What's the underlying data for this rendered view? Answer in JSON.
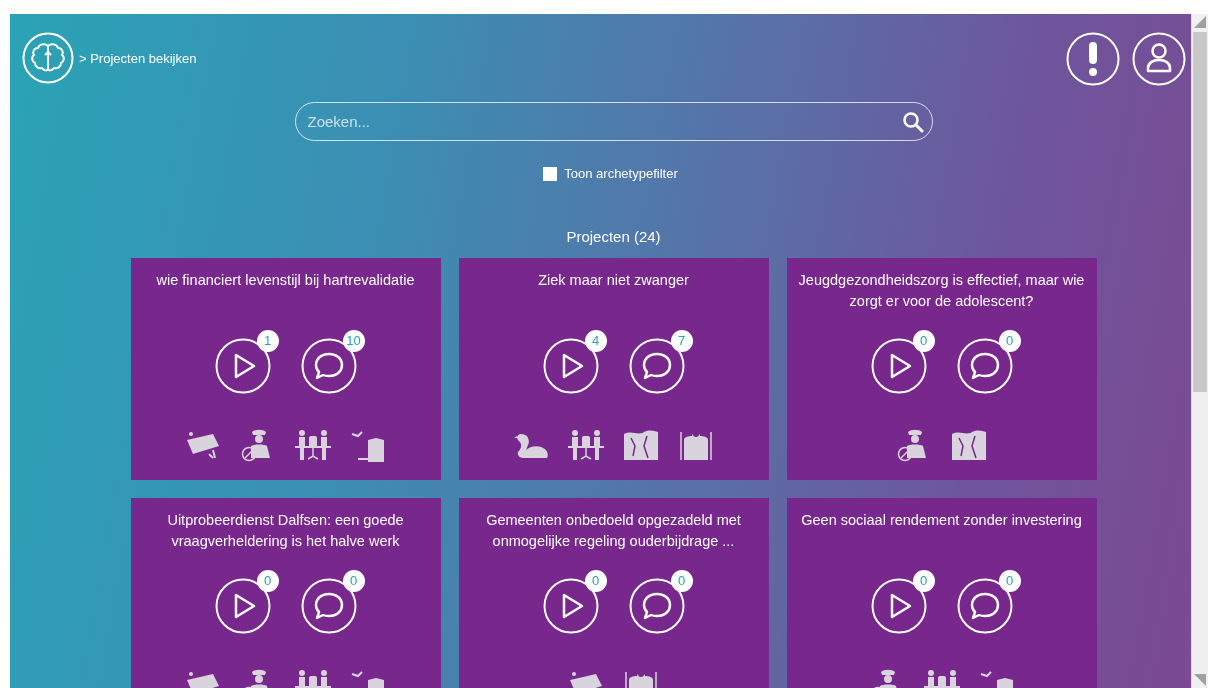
{
  "breadcrumb": "> Projecten bekijken",
  "search": {
    "placeholder": "Zoeken..."
  },
  "archetype_filter": {
    "label": "Toon archetypefilter",
    "checked": false
  },
  "projects_heading": "Projecten (24)",
  "projects": [
    {
      "title": "wie financiert levenstijl bij hartrevalidatie",
      "videos": "1",
      "comments": "10",
      "archetypes": [
        {
          "kind": "map"
        },
        {
          "kind": "officer"
        },
        {
          "kind": "meeting"
        },
        {
          "kind": "jumper"
        }
      ]
    },
    {
      "title": "Ziek maar niet zwanger",
      "videos": "4",
      "comments": "7",
      "archetypes": [
        {
          "kind": "swan"
        },
        {
          "kind": "meeting"
        },
        {
          "kind": "cliff"
        },
        {
          "kind": "bag"
        }
      ]
    },
    {
      "title": "Jeugdgezondheidszorg is effectief, maar wie zorgt er voor de adolescent?",
      "videos": "0",
      "comments": "0",
      "archetypes": [
        {
          "kind": "officer"
        },
        {
          "kind": "cliff"
        }
      ]
    },
    {
      "title": "Uitprobeerdienst Dalfsen: een goede vraagverheldering is het halve werk",
      "videos": "0",
      "comments": "0",
      "archetypes": [
        {
          "kind": "map"
        },
        {
          "kind": "officer"
        },
        {
          "kind": "meeting"
        },
        {
          "kind": "jumper"
        }
      ]
    },
    {
      "title": "Gemeenten onbedoeld opgezadeld met onmogelijke regeling ouderbijdrage ...",
      "videos": "0",
      "comments": "0",
      "archetypes": [
        {
          "kind": "map"
        },
        {
          "kind": "bag"
        }
      ]
    },
    {
      "title": "Geen sociaal rendement zonder investering",
      "videos": "0",
      "comments": "0",
      "archetypes": [
        {
          "kind": "officer"
        },
        {
          "kind": "meeting"
        },
        {
          "kind": "jumper"
        }
      ]
    }
  ]
}
